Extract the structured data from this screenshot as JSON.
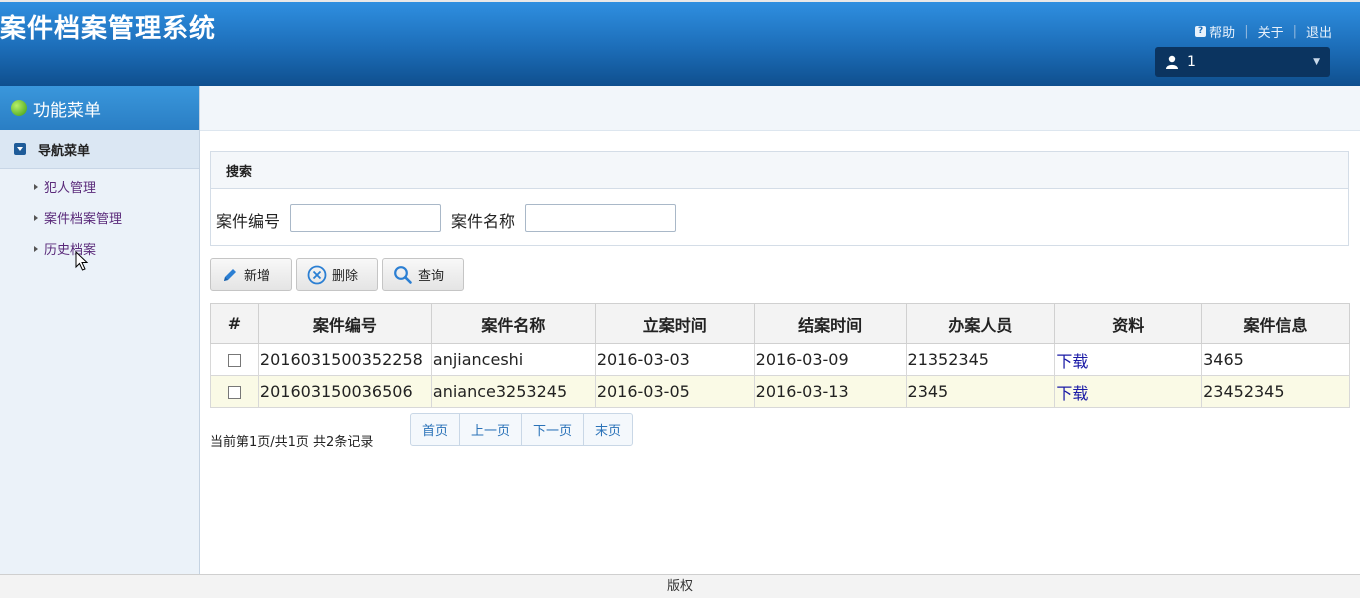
{
  "header": {
    "title": "案件档案管理系统",
    "links": {
      "help": "帮助",
      "about": "关于",
      "logout": "退出"
    },
    "user": {
      "name": "1"
    }
  },
  "sidebar": {
    "title": "功能菜单",
    "nav_title": "导航菜单",
    "items": [
      {
        "label": "犯人管理"
      },
      {
        "label": "案件档案管理"
      },
      {
        "label": "历史档案"
      }
    ]
  },
  "search": {
    "title": "搜索",
    "case_no_label": "案件编号",
    "case_name_label": "案件名称",
    "case_no_value": "",
    "case_name_value": ""
  },
  "toolbar": {
    "add": "新增",
    "delete": "删除",
    "query": "查询"
  },
  "table": {
    "headers": [
      "#",
      "案件编号",
      "案件名称",
      "立案时间",
      "结案时间",
      "办案人员",
      "资料",
      "案件信息"
    ],
    "rows": [
      {
        "case_no": "201603150035225​8",
        "name": "anjianceshi",
        "start": "2016-03-03",
        "end": "2016-03-09",
        "staff": "21352345",
        "file": "下载",
        "info": "3465"
      },
      {
        "case_no": "201603150036506",
        "name": "aniance3253245",
        "start": "2016-03-05",
        "end": "2016-03-13",
        "staff": "2345",
        "file": "下载",
        "info": "23452345"
      }
    ]
  },
  "pagination": {
    "info": "当前第1页/共1页 共2条记录",
    "first": "首页",
    "prev": "上一页",
    "next": "下一页",
    "last": "末页"
  },
  "footer": {
    "text": "版权"
  },
  "colors": {
    "header": "#1c6db8",
    "sidebar": "#ebf2f9",
    "alt_row": "#fafae6",
    "link": "#1a1aa6"
  },
  "icons": [
    "help-icon",
    "user-icon",
    "chevron-down-icon",
    "cube-icon",
    "nav-toggle-icon",
    "pencil-icon",
    "delete-circle-icon",
    "search-icon",
    "checkbox-icon"
  ]
}
